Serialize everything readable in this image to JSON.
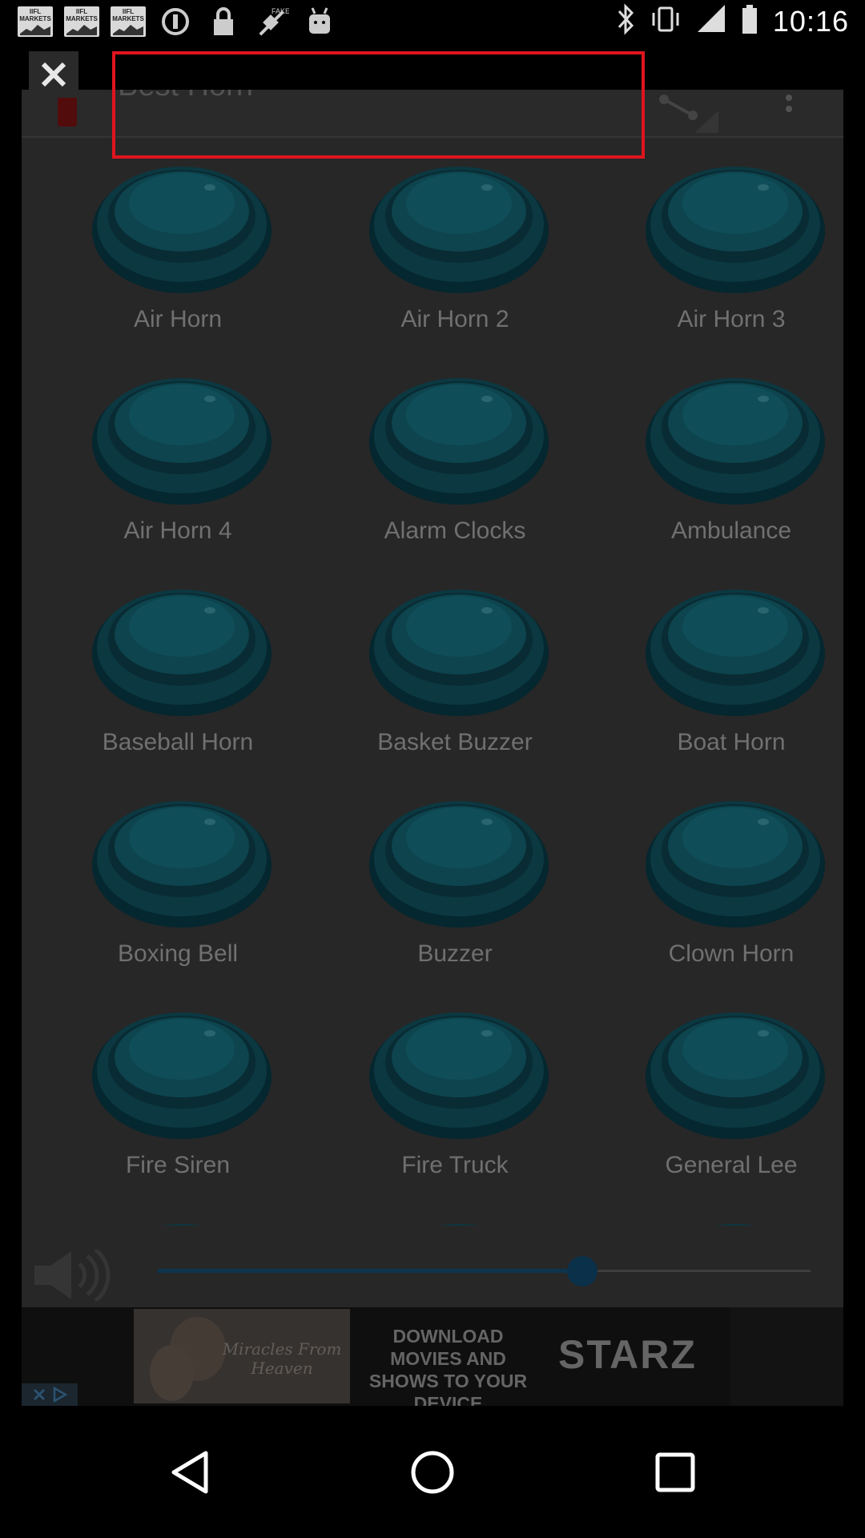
{
  "status_bar": {
    "time": "10:16",
    "market_label": "IIFL MARKETS",
    "left_icons": [
      "iifl-markets-icon",
      "iifl-markets-icon",
      "iifl-markets-icon",
      "do-not-disturb-icon",
      "lock-icon",
      "fake-gps-icon",
      "android-icon"
    ],
    "right_icons": [
      "bluetooth-icon",
      "vibrate-icon",
      "signal-icon",
      "battery-icon"
    ]
  },
  "toolbar": {
    "title": "Best Horn"
  },
  "sounds": [
    "Air Horn",
    "Air Horn 2",
    "Air Horn 3",
    "Air Horn 4",
    "Alarm Clocks",
    "Ambulance",
    "Baseball Horn",
    "Basket Buzzer",
    "Boat Horn",
    "Boxing Bell",
    "Buzzer",
    "Clown Horn",
    "Fire Siren",
    "Fire Truck",
    "General Lee",
    "",
    "",
    ""
  ],
  "volume": {
    "level": 0.65
  },
  "ad": {
    "image_text": "Miracles From Heaven",
    "text": "DOWNLOAD MOVIES AND SHOWS TO YOUR DEVICE",
    "brand": "STARZ"
  },
  "colors": {
    "highlight": "#e0141e",
    "button_teal": "#0e4a56",
    "label_text": "#7a7a7a"
  }
}
